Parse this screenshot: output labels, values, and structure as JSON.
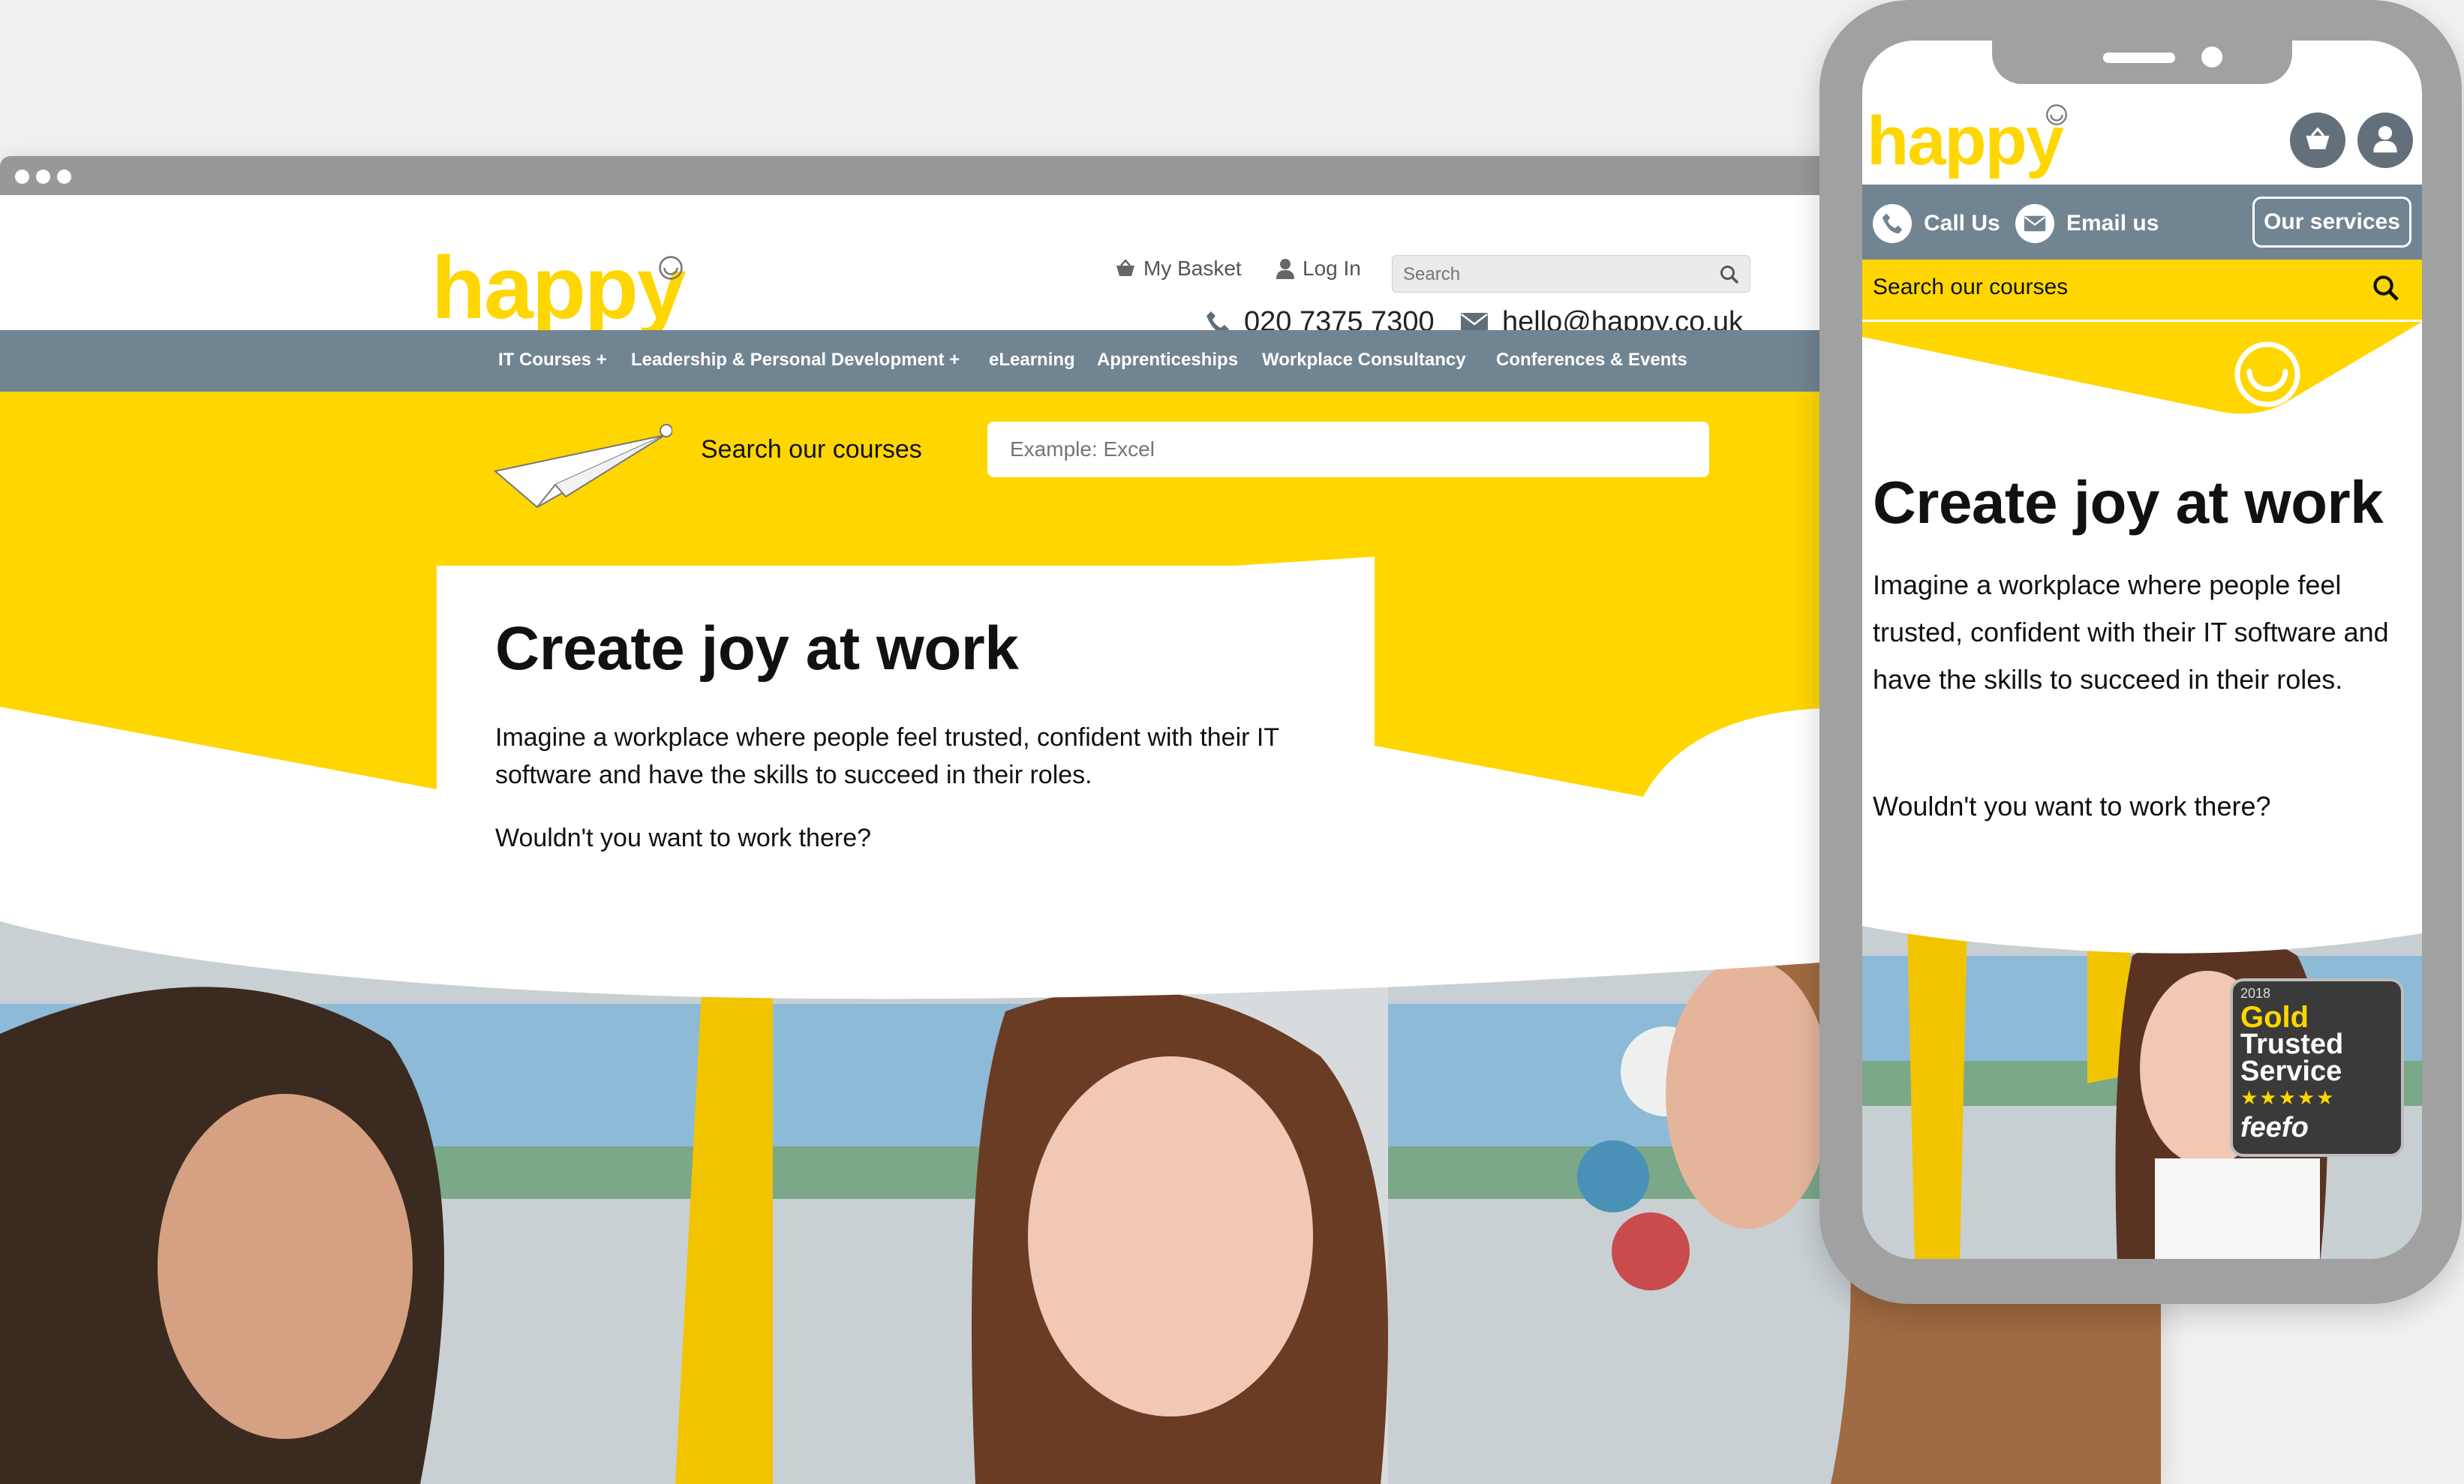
{
  "desktop": {
    "logo": "happy",
    "topnav": {
      "basket": "My Basket",
      "login": "Log In",
      "search_placeholder": "Search"
    },
    "contact": {
      "phone": "020 7375 7300",
      "email": "hello@happy.co.uk"
    },
    "mainnav": [
      "IT Courses +",
      "Leadership & Personal Development +",
      "eLearning",
      "Apprenticeships",
      "Workplace Consultancy",
      "Conferences & Events"
    ],
    "course_search": {
      "label": "Search our courses",
      "placeholder": "Example: Excel"
    },
    "hero": {
      "title": "Create joy at work",
      "body": "Imagine a workplace where people feel trusted, confident with their IT software and have the skills to succeed in their roles.",
      "question": "Wouldn't you want to work there?"
    }
  },
  "mobile": {
    "logo": "happy",
    "actions": {
      "call": "Call Us",
      "email": "Email us",
      "services": "Our services"
    },
    "search_label": "Search our courses",
    "hero": {
      "title": "Create joy at work",
      "body": "Imagine a workplace where people feel trusted, confident with their IT software and have the skills to succeed in their roles.",
      "question": "Wouldn't you want to work there?"
    },
    "badge": {
      "year": "2018",
      "line1": "Gold",
      "line2": "Trusted",
      "line3": "Service",
      "stars": "★★★★★",
      "brand": "feefo"
    }
  },
  "colors": {
    "brand_yellow": "#ffd600",
    "nav_slate": "#718492",
    "frame_gray": "#a1a1a1"
  },
  "icons": [
    "basket-icon",
    "user-icon",
    "search-icon",
    "phone-icon",
    "envelope-icon",
    "paper-plane-icon",
    "smiley-icon"
  ]
}
